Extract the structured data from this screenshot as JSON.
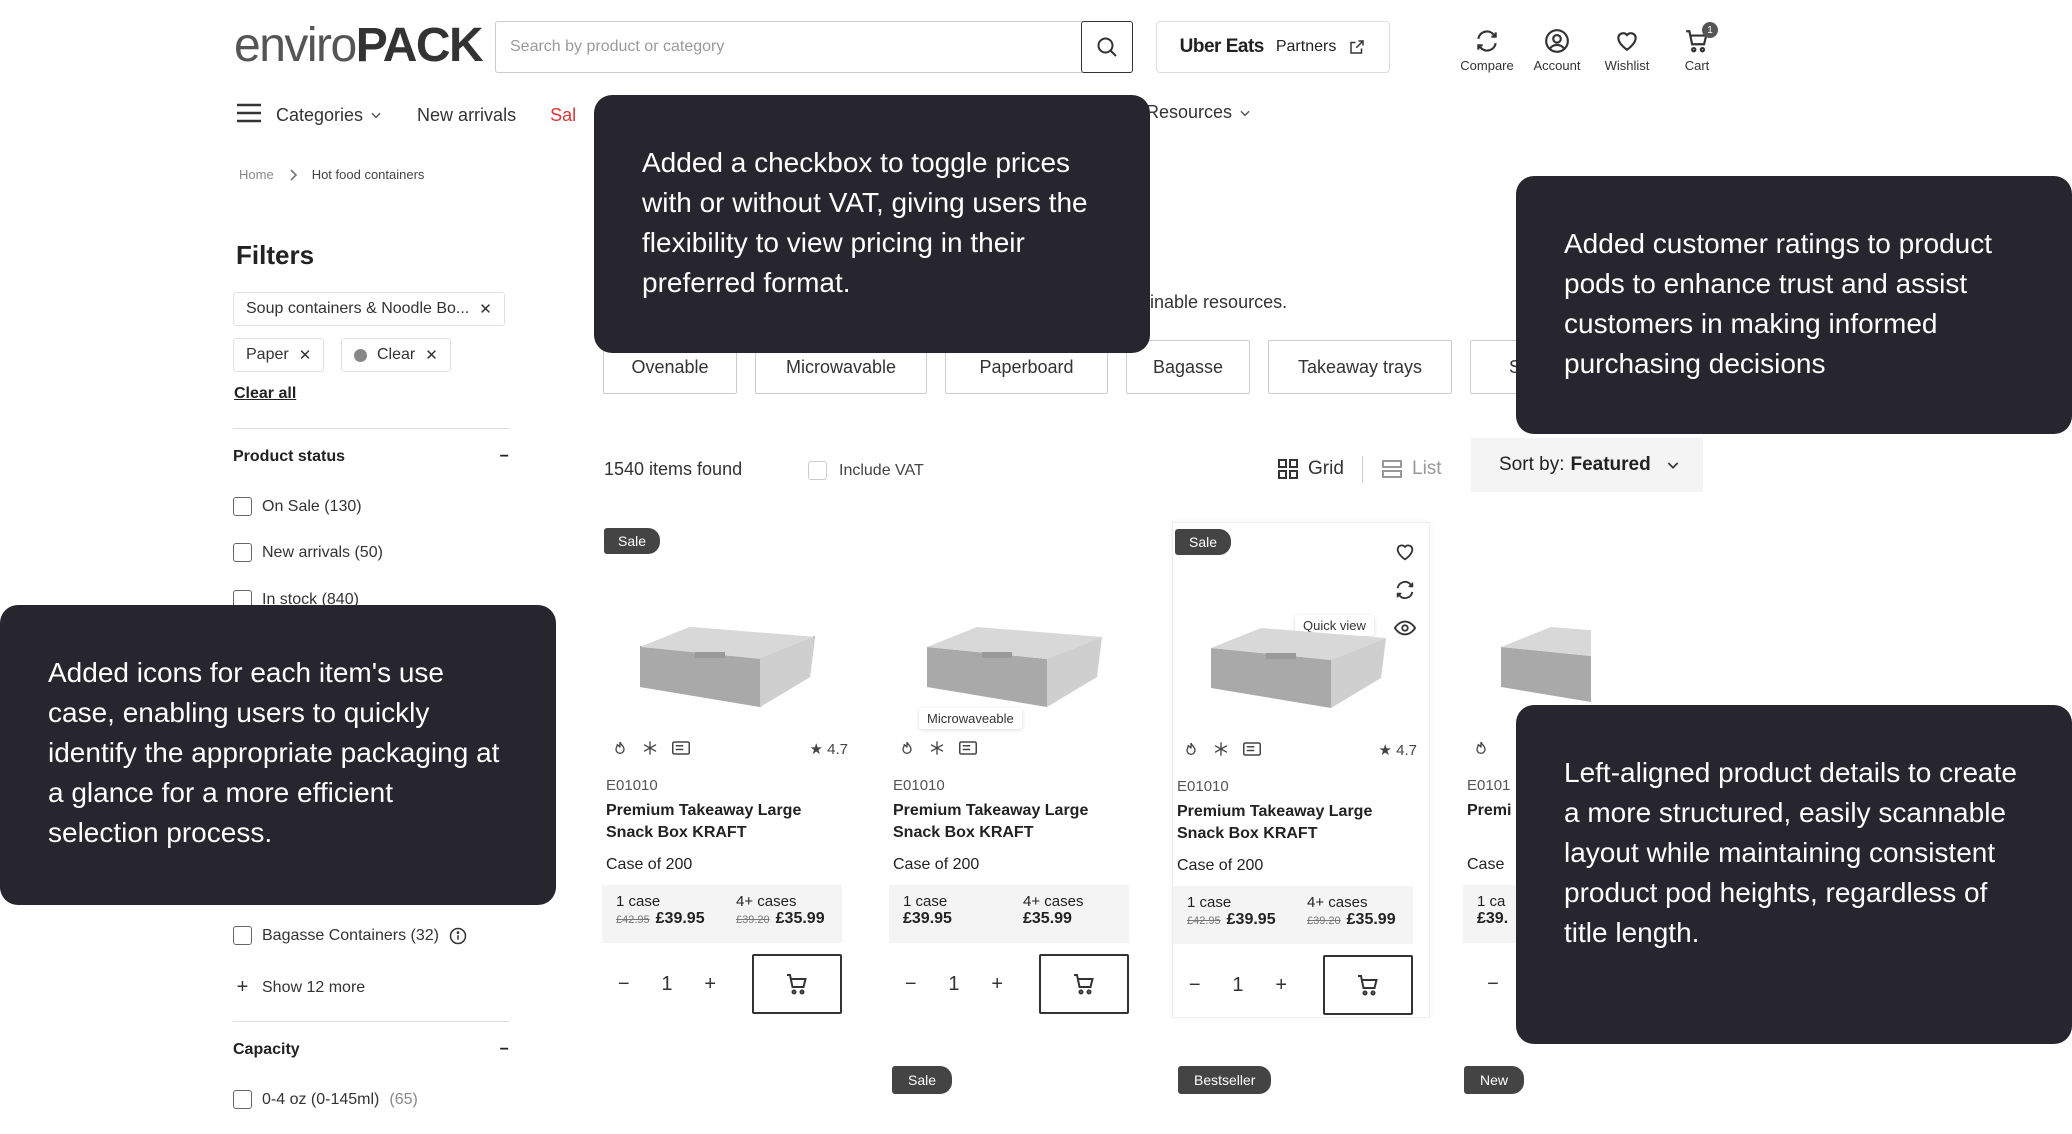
{
  "header": {
    "logo_light": "enviro",
    "logo_bold": "PACK",
    "search_placeholder": "Search by product or category",
    "uber_brand": "Uber Eats",
    "uber_label": "Partners",
    "icons": [
      {
        "label": "Compare",
        "icon": "compare-icon"
      },
      {
        "label": "Account",
        "icon": "account-icon"
      },
      {
        "label": "Wishlist",
        "icon": "heart-icon"
      },
      {
        "label": "Cart",
        "icon": "cart-icon",
        "badge": "1"
      }
    ]
  },
  "nav": {
    "categories": "Categories",
    "new_arrivals": "New arrivals",
    "sale": "Sal",
    "resources": "Resources"
  },
  "breadcrumb": {
    "home": "Home",
    "current": "Hot food containers"
  },
  "filters": {
    "title": "Filters",
    "chips": [
      "Soup containers & Noodle Bo...",
      "Paper",
      "Clear"
    ],
    "clear_all": "Clear all",
    "product_status": {
      "title": "Product status",
      "toggle": "−",
      "items": [
        "On Sale (130)",
        "New arrivals (50)",
        "In stock (840)"
      ]
    },
    "bagasse": {
      "label": "Bagasse Containers (32)"
    },
    "show_more": "Show 12 more",
    "capacity": {
      "title": "Capacity",
      "toggle": "−",
      "item_label": "0-4 oz (0-145ml)",
      "item_count": "(65)"
    }
  },
  "page": {
    "sustainable_text": "ainable resources.",
    "categories": [
      "Ovenable",
      "Microwavable",
      "Paperboard",
      "Bagasse",
      "Takeaway trays",
      "So"
    ],
    "items_found": "1540 items found",
    "include_vat": "Include VAT",
    "grid": "Grid",
    "list": "List",
    "sort_label": "Sort by:",
    "sort_value": "Featured"
  },
  "products": [
    {
      "tag": "Sale",
      "rating": "★ 4.7",
      "code": "E01010",
      "title": "Premium Takeaway Large Snack Box KRAFT",
      "case": "Case of 200",
      "p1_label": "1 case",
      "p1_old": "£42.95",
      "p1": "£39.95",
      "p2_label": "4+ cases",
      "p2_old": "£39.20",
      "p2": "£35.99",
      "qty": "1"
    },
    {
      "tag": "",
      "rating": "",
      "code": "E01010",
      "title": "Premium Takeaway Large Snack Box KRAFT",
      "case": "Case of 200",
      "p1_label": "1 case",
      "p1_old": "",
      "p1": "£39.95",
      "p2_label": "4+ cases",
      "p2_old": "",
      "p2": "£35.99",
      "qty": "1",
      "tooltip": "Microwaveable"
    },
    {
      "tag": "Sale",
      "rating": "★ 4.7",
      "code": "E01010",
      "title": "Premium Takeaway Large Snack Box KRAFT",
      "case": "Case of 200",
      "p1_label": "1 case",
      "p1_old": "£42.95",
      "p1": "£39.95",
      "p2_label": "4+ cases",
      "p2_old": "£39.20",
      "p2": "£35.99",
      "qty": "1",
      "tooltip": "Quick view"
    },
    {
      "tag": "",
      "rating": "",
      "code": "E0101",
      "title": "Premi Snack",
      "case": "Case",
      "p1_label": "1 ca",
      "p1_old": "",
      "p1": "£39.",
      "p2_label": "",
      "p2_old": "",
      "p2": "",
      "qty": ""
    }
  ],
  "bottom_tags": [
    "Sale",
    "Bestseller",
    "New"
  ],
  "callouts": {
    "vat": "Added a checkbox to toggle prices with or without VAT, giving users the flexibility to view pricing in their preferred format.",
    "ratings": "Added customer ratings to product pods to enhance trust and assist customers in making informed purchasing decisions",
    "icons": "Added icons for each item's use case, enabling users to quickly identify the appropriate packaging at a glance for a more efficient selection process.",
    "details": "Left-aligned product details to create a more structured, easily scannable layout while maintaining consistent product pod heights, regardless of title length."
  }
}
